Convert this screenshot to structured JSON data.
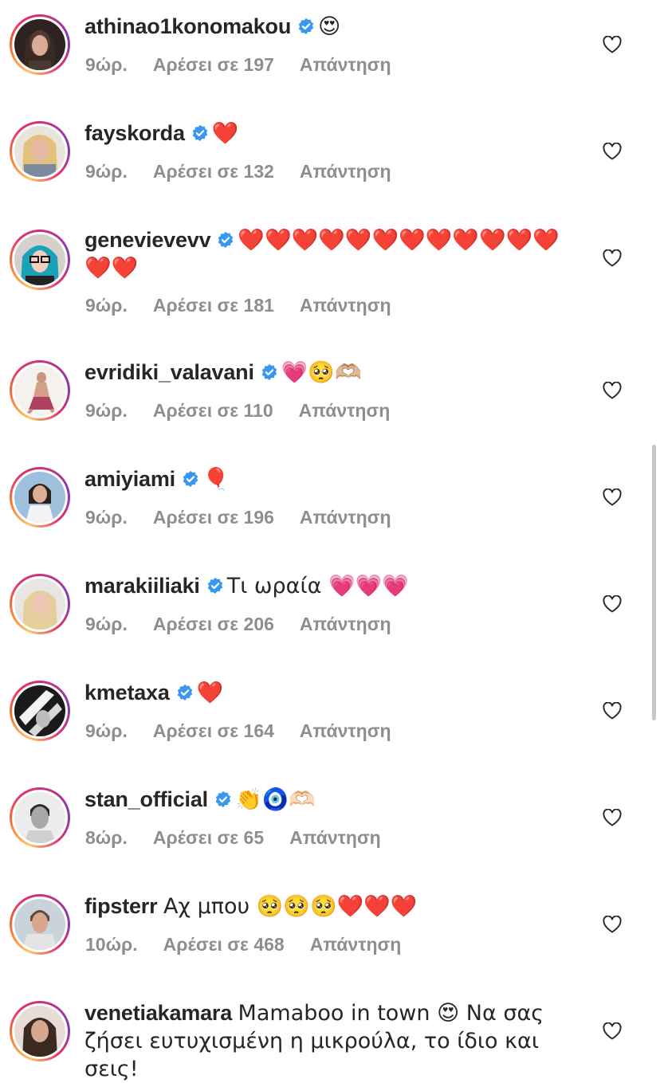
{
  "comments": [
    {
      "username": "athinao1konomakou",
      "text": "😍",
      "time": "9ώρ.",
      "likes": "Αρέσει σε 197",
      "reply": "Απάντηση",
      "verified": true
    },
    {
      "username": "fayskorda",
      "text": "❤️",
      "time": "9ώρ.",
      "likes": "Αρέσει σε 132",
      "reply": "Απάντηση",
      "verified": true
    },
    {
      "username": "genevievevv",
      "text": "❤️❤️❤️❤️❤️❤️❤️❤️❤️❤️❤️❤️❤️❤️",
      "time": "9ώρ.",
      "likes": "Αρέσει σε 181",
      "reply": "Απάντηση",
      "verified": true
    },
    {
      "username": "evridiki_valavani",
      "text": "💗🥺🫶🏼",
      "time": "9ώρ.",
      "likes": "Αρέσει σε 110",
      "reply": "Απάντηση",
      "verified": true
    },
    {
      "username": "amiyiami",
      "text": "🎈",
      "time": "9ώρ.",
      "likes": "Αρέσει σε 196",
      "reply": "Απάντηση",
      "verified": true
    },
    {
      "username": "marakiiliaki",
      "text": "Τι ωραία 💗💗💗",
      "time": "9ώρ.",
      "likes": "Αρέσει σε 206",
      "reply": "Απάντηση",
      "verified": true
    },
    {
      "username": "kmetaxa",
      "text": "❤️",
      "time": "9ώρ.",
      "likes": "Αρέσει σε 164",
      "reply": "Απάντηση",
      "verified": true
    },
    {
      "username": "stan_official",
      "text": "👏🧿🫶🏻",
      "time": "8ώρ.",
      "likes": "Αρέσει σε 65",
      "reply": "Απάντηση",
      "verified": true
    },
    {
      "username": "fipsterr",
      "text": "Αχ μπου 🥺🥺🥺❤️❤️❤️",
      "time": "10ώρ.",
      "likes": "Αρέσει σε 468",
      "reply": "Απάντηση",
      "verified": false
    },
    {
      "username": "venetiakamara",
      "text": "Mamaboo in town 😍 Να σας ζήσει ευτυχισμένη η μικρούλα, το ίδιο και σεις!",
      "time": "",
      "likes": "",
      "reply": "",
      "verified": false
    }
  ],
  "icons": {
    "verified": "verified-badge-icon",
    "like": "heart-outline-icon"
  },
  "colors": {
    "verified_blue": "#3897f0",
    "meta_gray": "#8e8e8e",
    "text": "#262626"
  }
}
